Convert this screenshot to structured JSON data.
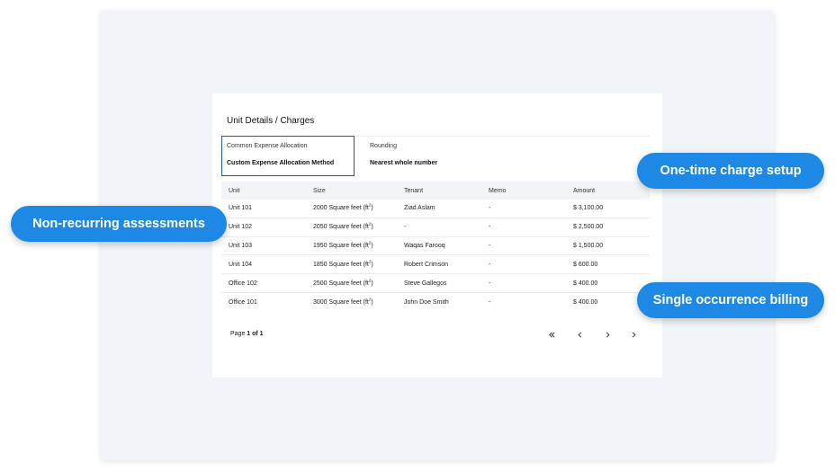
{
  "card": {
    "title": "Unit Details / Charges",
    "allocation": {
      "label": "Common Expense Allocation",
      "value": "Custom Expense Allocation Method"
    },
    "rounding": {
      "label": "Rounding",
      "value": "Nearest whole number"
    }
  },
  "table": {
    "headers": [
      "Unit",
      "Size",
      "Tenant",
      "Memo",
      "Amount"
    ],
    "rows": [
      {
        "unit": "Unit 101",
        "size": "2000 Square feet (ft",
        "tenant": "Ziad Aslam",
        "memo": "-",
        "amount": "$ 3,100.00"
      },
      {
        "unit": "Unit 102",
        "size": "2050 Square feet (ft",
        "tenant": "-",
        "memo": "-",
        "amount": "$ 2,500.00"
      },
      {
        "unit": "Unit 103",
        "size": "1950 Square feet (ft",
        "tenant": "Waqas Farooq",
        "memo": "-",
        "amount": "$ 1,500.00"
      },
      {
        "unit": "Unit 104",
        "size": "1850 Square feet (ft",
        "tenant": "Robert Crimson",
        "memo": "-",
        "amount": "$ 600.00"
      },
      {
        "unit": "Office 102",
        "size": "2500 Square feet (ft",
        "tenant": "Steve Gallegos",
        "memo": "-",
        "amount": "$ 400.00"
      },
      {
        "unit": "Office 101",
        "size": "3000 Square feet (ft",
        "tenant": "John Doe Smith",
        "memo": "-",
        "amount": "$ 400.00"
      }
    ],
    "size_suffix_sup": "2",
    "size_suffix_close": ")"
  },
  "pagination": {
    "prefix": "Page ",
    "current": "1 of 1",
    "first_icon": "double-chevron-left-icon",
    "prev_icon": "chevron-left-icon",
    "next_icon": "chevron-right-icon",
    "last_icon": "chevron-right-icon"
  },
  "callouts": {
    "one_time": "One-time charge setup",
    "non_recurring": "Non-recurring assessments",
    "single_occurrence": "Single occurrence billing"
  },
  "colors": {
    "callout": "#1e88e5",
    "allocation_border": "#1d5a9c",
    "backdrop": "#f1f5f9"
  }
}
